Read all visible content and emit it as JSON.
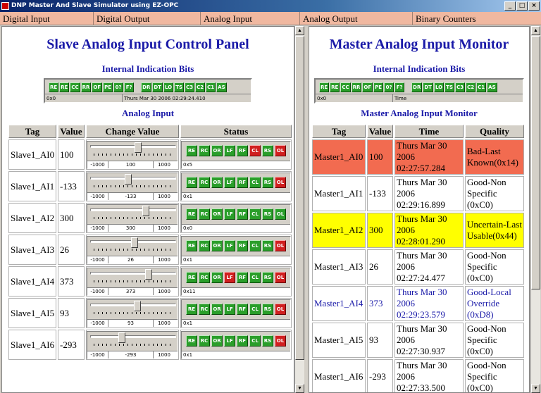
{
  "window": {
    "title": "DNP Master And Slave Simulator using EZ-OPC",
    "min": "_",
    "max": "□",
    "close": "×"
  },
  "tabs": [
    "Digital Input",
    "Digital Output",
    "Analog Input",
    "Analog Output",
    "Binary Counters"
  ],
  "bits": [
    "RE",
    "RE",
    "CC",
    "RR",
    "OF",
    "PE",
    "0?",
    "F?",
    "DR",
    "DT",
    "LO",
    "TS",
    "C3",
    "C2",
    "C1",
    "AS"
  ],
  "slave": {
    "title": "Slave Analog Input Control Panel",
    "iib_title": "Internal Indication Bits",
    "iib_hex": "0x0",
    "iib_time": "Thurs Mar 30 2006 02:29:24.410",
    "section_title": "Analog Input",
    "headers": [
      "Tag",
      "Value",
      "Change Value",
      "Status"
    ],
    "slider_min": "-1000",
    "slider_max": "1000",
    "status_labels": [
      "RE",
      "RC",
      "OR",
      "LF",
      "RF",
      "CL",
      "RS",
      "OL"
    ],
    "rows": [
      {
        "tag": "Slave1_AI0",
        "value": "100",
        "slider": 100,
        "hex": "0x5",
        "flags": [
          1,
          1,
          1,
          1,
          1,
          0,
          1,
          0
        ]
      },
      {
        "tag": "Slave1_AI1",
        "value": "-133",
        "slider": -133,
        "hex": "0x1",
        "flags": [
          1,
          1,
          1,
          1,
          1,
          1,
          1,
          0
        ]
      },
      {
        "tag": "Slave1_AI2",
        "value": "300",
        "slider": 300,
        "hex": "0x0",
        "flags": [
          1,
          1,
          1,
          1,
          1,
          1,
          1,
          1
        ]
      },
      {
        "tag": "Slave1_AI3",
        "value": "26",
        "slider": 26,
        "hex": "0x1",
        "flags": [
          1,
          1,
          1,
          1,
          1,
          1,
          1,
          0
        ]
      },
      {
        "tag": "Slave1_AI4",
        "value": "373",
        "slider": 373,
        "hex": "0x11",
        "flags": [
          1,
          1,
          1,
          0,
          1,
          1,
          1,
          0
        ]
      },
      {
        "tag": "Slave1_AI5",
        "value": "93",
        "slider": 93,
        "hex": "0x1",
        "flags": [
          1,
          1,
          1,
          1,
          1,
          1,
          1,
          0
        ]
      },
      {
        "tag": "Slave1_AI6",
        "value": "-293",
        "slider": -293,
        "hex": "0x1",
        "flags": [
          1,
          1,
          1,
          1,
          1,
          1,
          1,
          0
        ]
      }
    ]
  },
  "master": {
    "title": "Master Analog Input Monitor",
    "iib_title": "Internal Indication Bits",
    "iib_hex": "0x0",
    "iib_time": "Time",
    "section_title": "Master Analog Input Monitor",
    "headers": [
      "Tag",
      "Value",
      "Time",
      "Quality"
    ],
    "rows": [
      {
        "tag": "Master1_AI0",
        "value": "100",
        "time": "Thurs Mar 30 2006 02:27:57.284",
        "quality": "Bad-Last Known(0x14)",
        "bg": "#f26b50",
        "fg": "#000"
      },
      {
        "tag": "Master1_AI1",
        "value": "-133",
        "time": "Thurs Mar 30 2006 02:29:16.899",
        "quality": "Good-Non Specific (0xC0)",
        "bg": "#ffffff",
        "fg": "#000"
      },
      {
        "tag": "Master1_AI2",
        "value": "300",
        "time": "Thurs Mar 30 2006 02:28:01.290",
        "quality": "Uncertain-Last Usable(0x44)",
        "bg": "#ffff00",
        "fg": "#000"
      },
      {
        "tag": "Master1_AI3",
        "value": "26",
        "time": "Thurs Mar 30 2006 02:27:24.477",
        "quality": "Good-Non Specific (0xC0)",
        "bg": "#ffffff",
        "fg": "#000"
      },
      {
        "tag": "Master1_AI4",
        "value": "373",
        "time": "Thurs Mar 30 2006 02:29:23.579",
        "quality": "Good-Local Override (0xD8)",
        "bg": "#ffffff",
        "fg": "#1a1aa8"
      },
      {
        "tag": "Master1_AI5",
        "value": "93",
        "time": "Thurs Mar 30 2006 02:27:30.937",
        "quality": "Good-Non Specific (0xC0)",
        "bg": "#ffffff",
        "fg": "#000"
      },
      {
        "tag": "Master1_AI6",
        "value": "-293",
        "time": "Thurs Mar 30 2006 02:27:33.500",
        "quality": "Good-Non Specific (0xC0)",
        "bg": "#ffffff",
        "fg": "#000"
      }
    ]
  }
}
